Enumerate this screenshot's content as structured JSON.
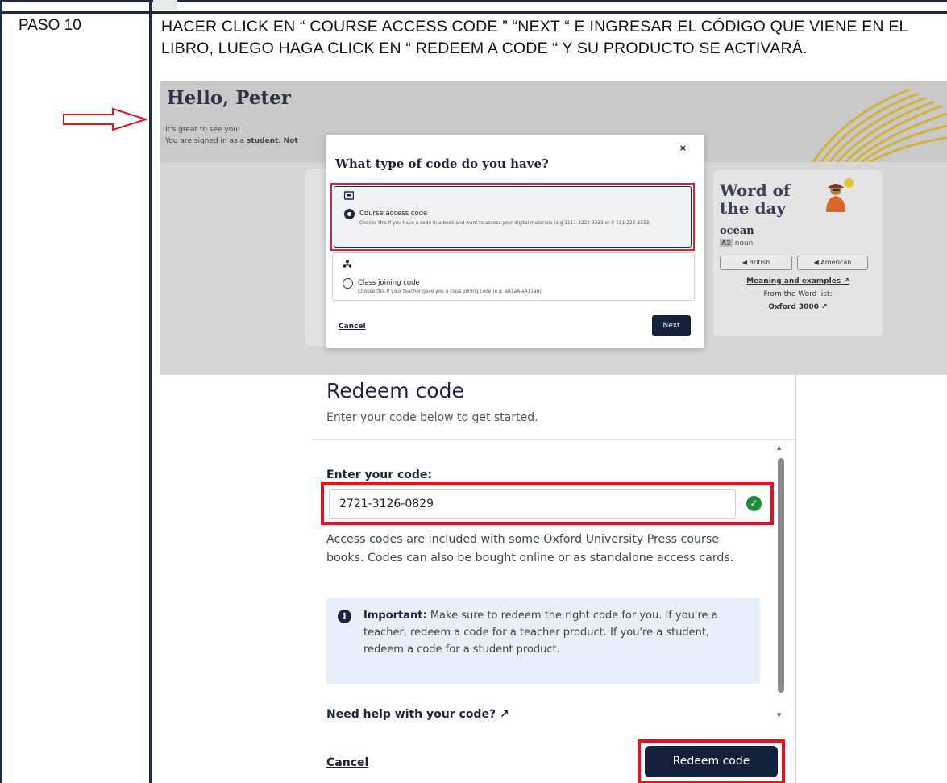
{
  "step": {
    "label": "PASO 10",
    "instruction": "HACER CLICK EN “ COURSE ACCESS CODE ” “NEXT “ E INGRESAR EL CÓDIGO QUE VIENE EN EL LIBRO, LUEGO HAGA CLICK EN “ REDEEM A CODE “ Y SU PRODUCTO SE ACTIVARÁ."
  },
  "dashboard": {
    "greeting": "Hello, Peter",
    "welcome": "It's great to see you!",
    "signed_in_prefix": "You are signed in as a",
    "signed_in_role": "student.",
    "not_link": "Not"
  },
  "modal": {
    "title": "What type of code do you have?",
    "close": "×",
    "options": [
      {
        "label": "Course access code",
        "description": "Choose this if you have a code in a book and want to access your digital materials (e.g 1111-2222-3333 or S-111-222-3333)",
        "selected": true
      },
      {
        "label": "Class joining code",
        "description": "Choose this if your teacher gave you a class joining code (e.g. aA1aA-aA11aA)",
        "selected": false
      }
    ],
    "cancel": "Cancel",
    "next": "Next"
  },
  "word_of_day": {
    "title_line1": "Word of",
    "title_line2": "the day",
    "word": "ocean",
    "level": "A2",
    "pos": "noun",
    "btn_british": "◀ British",
    "btn_american": "◀ American",
    "meaning_link": "Meaning and examples ↗",
    "from_list": "From the Word list:",
    "list_link": "Oxford 3000 ↗"
  },
  "redeem": {
    "title": "Redeem code",
    "subtitle": "Enter your code below to get started.",
    "field_label": "Enter your code:",
    "code_value": "2721-3126-0829",
    "info": "Access codes are included with some Oxford University Press course books. Codes can also be bought online or as standalone access cards.",
    "important_label": "Important:",
    "important_text": "Make sure to redeem the right code for you. If you're a teacher, redeem a code for a teacher product. If you're a student, redeem a code for a student product.",
    "help_link": "Need help with your code? ↗",
    "cancel": "Cancel",
    "submit": "Redeem code"
  },
  "colors": {
    "highlight_red": "#e3121b",
    "navy": "#14213d",
    "success_green": "#1f8a3a",
    "info_blue_bg": "#e6f0fa"
  }
}
